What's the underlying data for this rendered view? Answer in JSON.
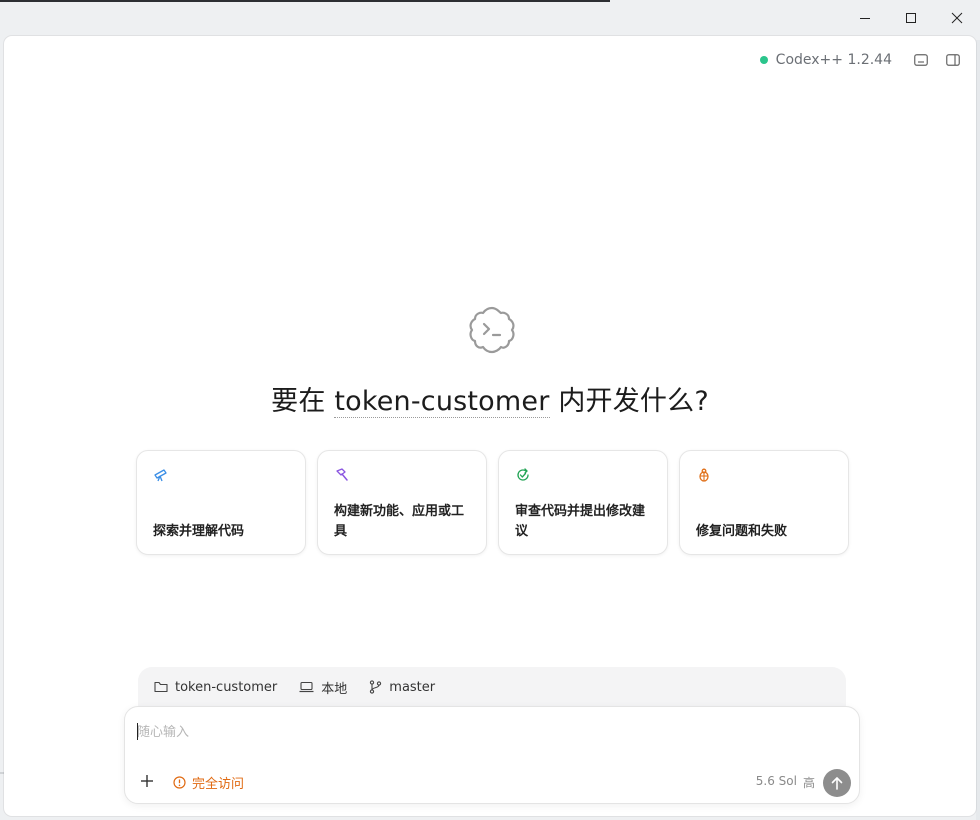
{
  "window": {
    "controls": [
      "minimize",
      "maximize",
      "close"
    ]
  },
  "status": {
    "dot_color": "#2bc58c",
    "text": "Codex++ 1.2.44",
    "icons": [
      "terminal-icon",
      "panel-icon"
    ]
  },
  "main": {
    "hero_icon": "terminal-cloud-icon",
    "heading_prefix": "要在 ",
    "project": "token-customer",
    "heading_suffix": " 内开发什么?"
  },
  "cards": [
    {
      "icon": "telescope-icon",
      "icon_color": "#3a8ee6",
      "label": "探索并理解代码"
    },
    {
      "icon": "hammer-icon",
      "icon_color": "#8a55e0",
      "label": "构建新功能、应用或工具"
    },
    {
      "icon": "refresh-check-icon",
      "icon_color": "#22a455",
      "label": "审查代码并提出修改建议"
    },
    {
      "icon": "bug-icon",
      "icon_color": "#e0701a",
      "label": "修复问题和失败"
    }
  ],
  "context": {
    "folder": "token-customer",
    "environment": "本地",
    "branch": "master"
  },
  "composer": {
    "placeholder": "随心输入",
    "access_label": "完全访问",
    "access_color": "#e06a12",
    "model": "5.6 Sol",
    "effort": "高"
  }
}
